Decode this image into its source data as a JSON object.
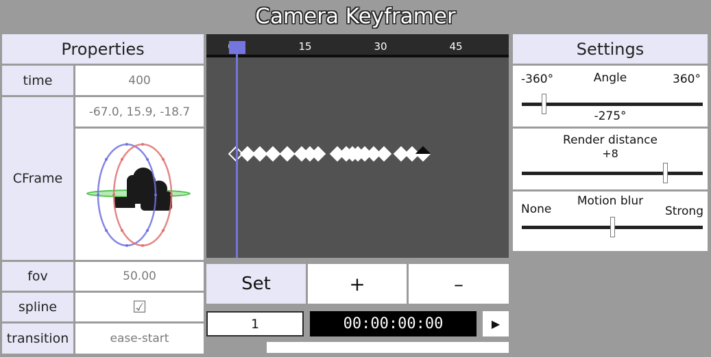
{
  "title": "Camera Keyframer",
  "properties": {
    "header": "Properties",
    "rows": {
      "time": {
        "label": "time",
        "value": "400"
      },
      "cframe": {
        "label": "CFrame",
        "value": "-67.0,  15.9,  -18.7"
      },
      "fov": {
        "label": "fov",
        "value": "50.00"
      },
      "spline": {
        "label": "spline",
        "value": "☑"
      },
      "transition": {
        "label": "transition",
        "value": "ease-start"
      }
    }
  },
  "timeline": {
    "ticks": [
      "0",
      "15",
      "30",
      "45"
    ],
    "keyframe_count": 18
  },
  "controls": {
    "set_label": "Set",
    "add_label": "+",
    "remove_label": "–",
    "frame_value": "1",
    "timecode": "00:00:00:00",
    "play_icon": "▶",
    "progress": 0.2
  },
  "settings": {
    "header": "Settings",
    "angle": {
      "label": "Angle",
      "min": "-360°",
      "max": "360°",
      "value": "-275°",
      "position": 0.12
    },
    "render_distance": {
      "label": "Render distance",
      "value": "+8",
      "position": 0.79
    },
    "motion_blur": {
      "label": "Motion blur",
      "min": "None",
      "max": "Strong",
      "position": 0.5
    }
  },
  "colors": {
    "background": "#9b9b9b",
    "header_bg": "#e7e7f7",
    "playhead": "#7575e0",
    "timeline_bg": "#525252",
    "gizmo_x": "#e07070",
    "gizmo_y": "#7070e0",
    "gizmo_z": "#60d060"
  }
}
